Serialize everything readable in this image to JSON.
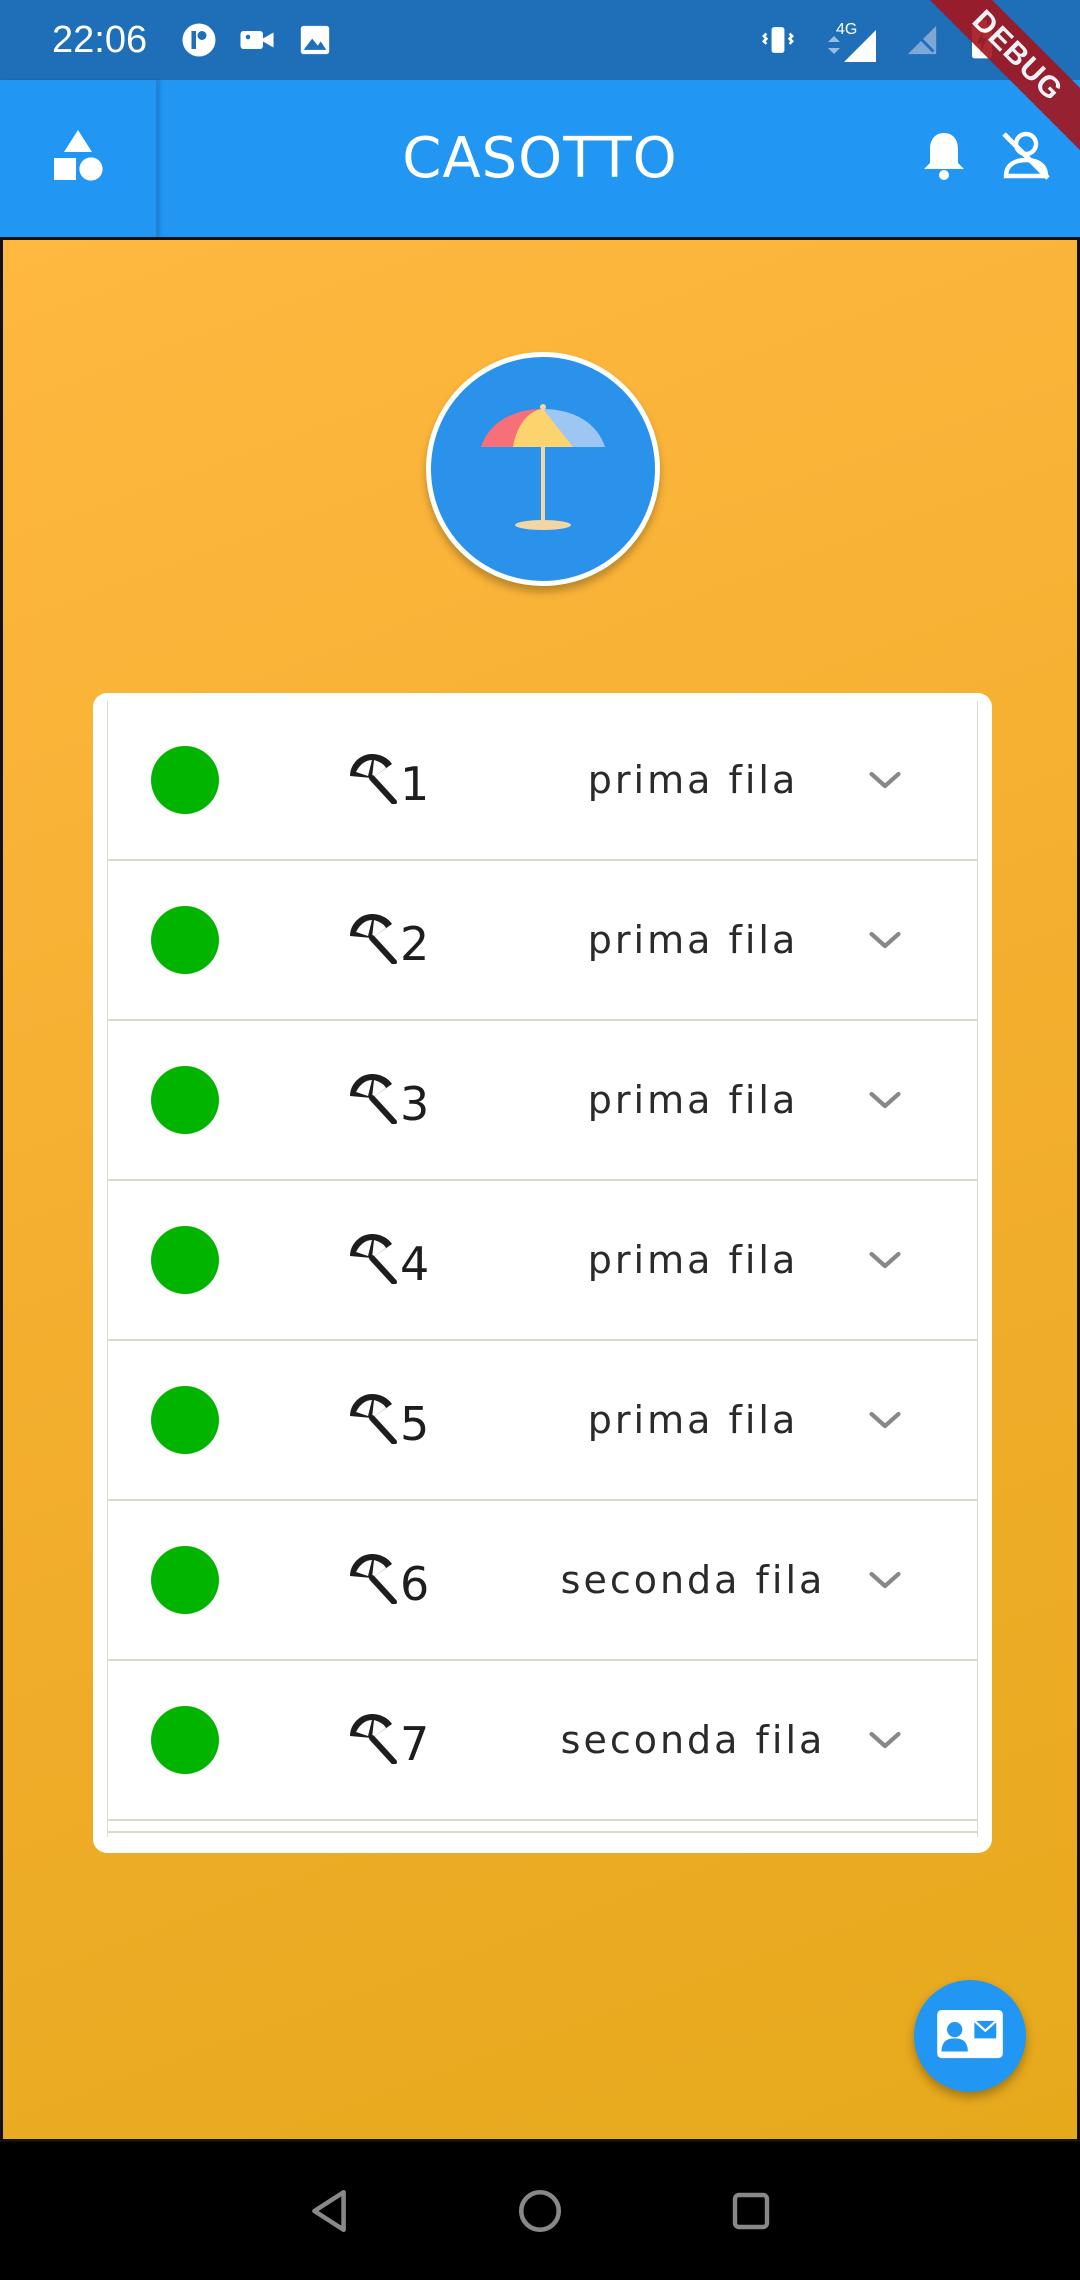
{
  "status_bar": {
    "time": "22:06",
    "left_icons": [
      "app-badge-icon",
      "video-camera-icon",
      "image-icon"
    ],
    "right_icons": [
      "vibrate-icon",
      "network-4g-icon",
      "signal-icon",
      "no-sim-icon",
      "battery-charging-icon"
    ],
    "network_label": "4G"
  },
  "debug_banner": "DEBUG",
  "app_bar": {
    "title": "CASOTTO",
    "leading_icon": "shapes-icon",
    "actions": [
      "bell-icon",
      "person-off-icon"
    ]
  },
  "colors": {
    "app_bar": "#2196f3",
    "status_bar": "#1f6fb8",
    "background_gradient_start": "#ffb840",
    "background_gradient_end": "#e6a91c",
    "status_available": "#00b400"
  },
  "umbrellas": [
    {
      "number": "1",
      "row": "prima fila"
    },
    {
      "number": "2",
      "row": "prima fila"
    },
    {
      "number": "3",
      "row": "prima fila"
    },
    {
      "number": "4",
      "row": "prima fila"
    },
    {
      "number": "5",
      "row": "prima fila"
    },
    {
      "number": "6",
      "row": "seconda fila"
    },
    {
      "number": "7",
      "row": "seconda fila"
    }
  ],
  "fab_icon": "contact-card-icon",
  "nav_bar": [
    "back-icon",
    "home-icon",
    "recents-icon"
  ]
}
